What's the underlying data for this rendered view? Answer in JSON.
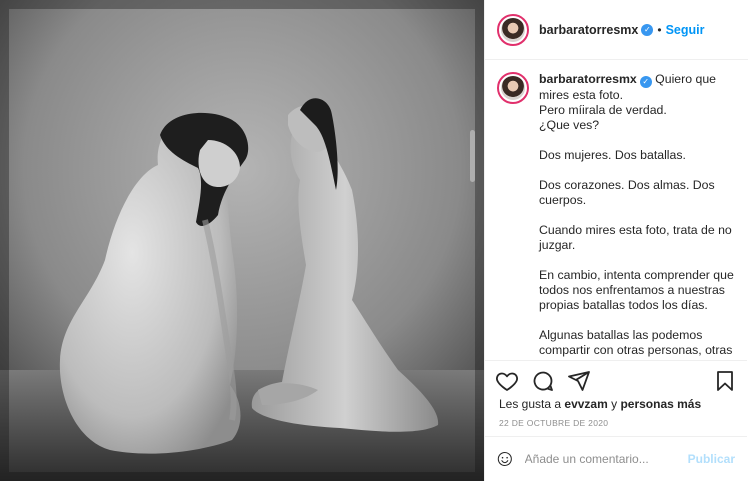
{
  "post": {
    "username": "barbaratorresmx",
    "follow_label": "Seguir",
    "separator": "•",
    "verified_glyph": "✓"
  },
  "caption": {
    "username": "barbaratorresmx",
    "lines": [
      "Quiero que mires esta foto.",
      "Pero míirala de verdad.",
      "¿Que ves?",
      "",
      "Dos mujeres. Dos batallas.",
      "",
      "Dos corazones. Dos almas. Dos cuerpos.",
      "",
      "Cuando mires esta foto, trata de no juzgar.",
      "",
      "En cambio, intenta comprender que todos nos enfrentamos a nuestras propias batallas todos los días.",
      "",
      "Algunas batallas las podemos compartir con otras personas, otras las guardamos para nosotros."
    ]
  },
  "likes": {
    "prefix": "Les gusta a ",
    "user": "evvzam",
    "middle": " y ",
    "others": "personas más"
  },
  "date": "22 DE OCTUBRE DE 2020",
  "comment": {
    "placeholder": "Añade un comentario...",
    "publish_label": "Publicar"
  },
  "colors": {
    "accent": "#0095f6",
    "publish_disabled": "#b2dffc",
    "border": "#efefef",
    "muted": "#8e8e8e"
  },
  "icons": {
    "like": "heart-icon",
    "comment": "comment-icon",
    "share": "share-icon",
    "save": "bookmark-icon",
    "emoji": "emoji-icon",
    "verified": "verified-icon"
  }
}
